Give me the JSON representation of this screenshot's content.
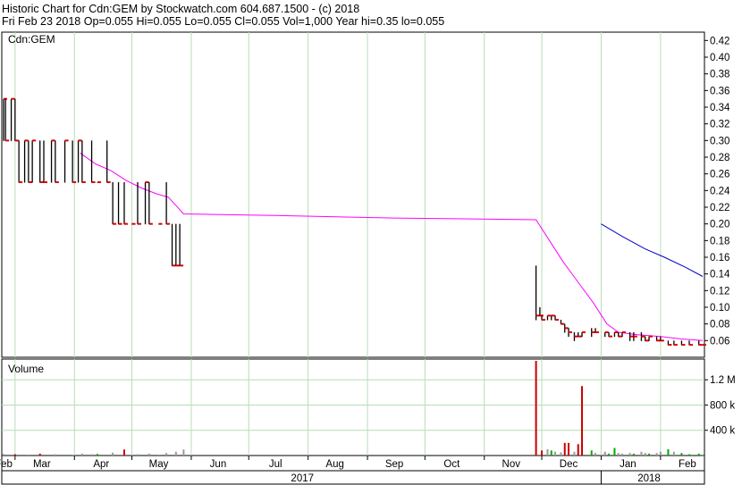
{
  "header": {
    "line1": "Historic Chart for Cdn:GEM by Stockwatch.com 604.687.1500 - (c) 2018",
    "line2": "Fri Feb 23 2018  Op=0.055  Hi=0.055  Lo=0.055  Cl=0.055  Vol=1,000  Year hi=0.35  lo=0.055"
  },
  "chart_data": {
    "type": "ohlc",
    "symbol_label": "Cdn:GEM",
    "price_axis": {
      "ylim": [
        0.04,
        0.43
      ],
      "ticks": [
        0.06,
        0.08,
        0.1,
        0.12,
        0.14,
        0.16,
        0.18,
        0.2,
        0.22,
        0.24,
        0.26,
        0.28,
        0.3,
        0.32,
        0.34,
        0.36,
        0.38,
        0.4,
        0.42
      ],
      "tick_labels": [
        "0.06",
        "0.08",
        "0.10",
        "0.12",
        "0.14",
        "0.16",
        "0.18",
        "0.20",
        "0.22",
        "0.24",
        "0.26",
        "0.28",
        "0.30",
        "0.32",
        "0.34",
        "0.36",
        "0.38",
        "0.40",
        "0.42"
      ]
    },
    "volume_axis": {
      "title": "Volume",
      "ylim": [
        0,
        1500000
      ],
      "ticks": [
        400000,
        800000,
        1200000
      ],
      "tick_labels": [
        "400 k",
        "800 k",
        "1.2 M"
      ]
    },
    "x_axis": {
      "range": [
        "2017-02-23",
        "2018-02-23"
      ],
      "month_labels": [
        {
          "label": "Feb",
          "date": "2017-02-23"
        },
        {
          "label": "Mar",
          "date": "2017-03-15"
        },
        {
          "label": "Apr",
          "date": "2017-04-15"
        },
        {
          "label": "May",
          "date": "2017-05-15"
        },
        {
          "label": "Jun",
          "date": "2017-06-15"
        },
        {
          "label": "Jul",
          "date": "2017-07-15"
        },
        {
          "label": "Aug",
          "date": "2017-08-15"
        },
        {
          "label": "Sep",
          "date": "2017-09-15"
        },
        {
          "label": "Oct",
          "date": "2017-10-15"
        },
        {
          "label": "Nov",
          "date": "2017-11-15"
        },
        {
          "label": "Dec",
          "date": "2017-12-15"
        },
        {
          "label": "Jan",
          "date": "2018-01-15"
        },
        {
          "label": "Feb",
          "date": "2018-02-15"
        }
      ],
      "month_grid": [
        "2017-03-01",
        "2017-04-01",
        "2017-05-01",
        "2017-06-01",
        "2017-07-01",
        "2017-08-01",
        "2017-09-01",
        "2017-10-01",
        "2017-11-01",
        "2017-12-01",
        "2018-01-01",
        "2018-02-01"
      ],
      "year_labels": [
        {
          "label": "2017",
          "date": "2017-07-29"
        },
        {
          "label": "2018",
          "date": "2018-01-26"
        }
      ],
      "year_divider": "2018-01-01"
    },
    "bars": [
      {
        "date": "2017-02-23",
        "high": 0.35,
        "low": 0.3,
        "close": 0.35
      },
      {
        "date": "2017-02-24",
        "high": 0.35,
        "low": 0.3,
        "close": 0.3
      },
      {
        "date": "2017-02-27",
        "high": 0.35,
        "low": 0.3,
        "close": 0.35
      },
      {
        "date": "2017-03-01",
        "high": 0.35,
        "low": 0.3,
        "close": 0.3
      },
      {
        "date": "2017-03-03",
        "high": 0.3,
        "low": 0.25,
        "close": 0.25
      },
      {
        "date": "2017-03-06",
        "high": 0.3,
        "low": 0.25,
        "close": 0.3
      },
      {
        "date": "2017-03-08",
        "high": 0.3,
        "low": 0.25,
        "close": 0.25
      },
      {
        "date": "2017-03-10",
        "high": 0.3,
        "low": 0.25,
        "close": 0.3
      },
      {
        "date": "2017-03-14",
        "high": 0.3,
        "low": 0.25,
        "close": 0.25
      },
      {
        "date": "2017-03-16",
        "high": 0.3,
        "low": 0.25,
        "close": 0.25
      },
      {
        "date": "2017-03-20",
        "high": 0.3,
        "low": 0.25,
        "close": 0.3
      },
      {
        "date": "2017-03-22",
        "high": 0.3,
        "low": 0.25,
        "close": 0.25
      },
      {
        "date": "2017-03-27",
        "high": 0.3,
        "low": 0.25,
        "close": 0.3
      },
      {
        "date": "2017-03-31",
        "high": 0.3,
        "low": 0.25,
        "close": 0.25
      },
      {
        "date": "2017-04-03",
        "high": 0.3,
        "low": 0.25,
        "close": 0.3
      },
      {
        "date": "2017-04-05",
        "high": 0.3,
        "low": 0.25,
        "close": 0.25
      },
      {
        "date": "2017-04-10",
        "high": 0.3,
        "low": 0.25,
        "close": 0.25
      },
      {
        "date": "2017-04-13",
        "high": 0.25,
        "low": 0.25,
        "close": 0.25
      },
      {
        "date": "2017-04-18",
        "high": 0.3,
        "low": 0.25,
        "close": 0.25
      },
      {
        "date": "2017-04-21",
        "high": 0.25,
        "low": 0.2,
        "close": 0.2
      },
      {
        "date": "2017-04-24",
        "high": 0.25,
        "low": 0.2,
        "close": 0.2
      },
      {
        "date": "2017-04-27",
        "high": 0.25,
        "low": 0.2,
        "close": 0.2
      },
      {
        "date": "2017-05-01",
        "high": 0.2,
        "low": 0.2,
        "close": 0.2
      },
      {
        "date": "2017-05-04",
        "high": 0.25,
        "low": 0.2,
        "close": 0.2
      },
      {
        "date": "2017-05-08",
        "high": 0.25,
        "low": 0.2,
        "close": 0.25
      },
      {
        "date": "2017-05-10",
        "high": 0.25,
        "low": 0.2,
        "close": 0.2
      },
      {
        "date": "2017-05-15",
        "high": 0.2,
        "low": 0.2,
        "close": 0.2
      },
      {
        "date": "2017-05-19",
        "high": 0.25,
        "low": 0.2,
        "close": 0.2
      },
      {
        "date": "2017-05-22",
        "high": 0.2,
        "low": 0.15,
        "close": 0.15
      },
      {
        "date": "2017-05-24",
        "high": 0.2,
        "low": 0.15,
        "close": 0.15
      },
      {
        "date": "2017-05-26",
        "high": 0.2,
        "low": 0.15,
        "close": 0.15
      },
      {
        "date": "2017-11-28",
        "high": 0.15,
        "low": 0.085,
        "close": 0.09
      },
      {
        "date": "2017-11-30",
        "high": 0.1,
        "low": 0.09,
        "close": 0.09
      },
      {
        "date": "2017-12-01",
        "high": 0.09,
        "low": 0.085,
        "close": 0.085
      },
      {
        "date": "2017-12-04",
        "high": 0.09,
        "low": 0.085,
        "close": 0.09
      },
      {
        "date": "2017-12-06",
        "high": 0.09,
        "low": 0.085,
        "close": 0.09
      },
      {
        "date": "2017-12-08",
        "high": 0.09,
        "low": 0.085,
        "close": 0.085
      },
      {
        "date": "2017-12-11",
        "high": 0.085,
        "low": 0.08,
        "close": 0.08
      },
      {
        "date": "2017-12-13",
        "high": 0.08,
        "low": 0.07,
        "close": 0.075
      },
      {
        "date": "2017-12-15",
        "high": 0.075,
        "low": 0.065,
        "close": 0.07
      },
      {
        "date": "2017-12-18",
        "high": 0.07,
        "low": 0.06,
        "close": 0.065
      },
      {
        "date": "2017-12-20",
        "high": 0.07,
        "low": 0.065,
        "close": 0.065
      },
      {
        "date": "2017-12-22",
        "high": 0.07,
        "low": 0.065,
        "close": 0.07
      },
      {
        "date": "2017-12-27",
        "high": 0.075,
        "low": 0.065,
        "close": 0.07
      },
      {
        "date": "2017-12-29",
        "high": 0.075,
        "low": 0.07,
        "close": 0.07
      },
      {
        "date": "2018-01-03",
        "high": 0.07,
        "low": 0.065,
        "close": 0.07
      },
      {
        "date": "2018-01-05",
        "high": 0.07,
        "low": 0.065,
        "close": 0.065
      },
      {
        "date": "2018-01-08",
        "high": 0.07,
        "low": 0.065,
        "close": 0.07
      },
      {
        "date": "2018-01-10",
        "high": 0.07,
        "low": 0.065,
        "close": 0.065
      },
      {
        "date": "2018-01-12",
        "high": 0.07,
        "low": 0.065,
        "close": 0.07
      },
      {
        "date": "2018-01-16",
        "high": 0.07,
        "low": 0.06,
        "close": 0.065
      },
      {
        "date": "2018-01-18",
        "high": 0.07,
        "low": 0.06,
        "close": 0.065
      },
      {
        "date": "2018-01-22",
        "high": 0.07,
        "low": 0.06,
        "close": 0.065
      },
      {
        "date": "2018-01-24",
        "high": 0.065,
        "low": 0.06,
        "close": 0.06
      },
      {
        "date": "2018-01-26",
        "high": 0.065,
        "low": 0.06,
        "close": 0.065
      },
      {
        "date": "2018-01-30",
        "high": 0.065,
        "low": 0.06,
        "close": 0.06
      },
      {
        "date": "2018-02-01",
        "high": 0.065,
        "low": 0.06,
        "close": 0.06
      },
      {
        "date": "2018-02-05",
        "high": 0.06,
        "low": 0.055,
        "close": 0.055
      },
      {
        "date": "2018-02-08",
        "high": 0.06,
        "low": 0.055,
        "close": 0.055
      },
      {
        "date": "2018-02-12",
        "high": 0.06,
        "low": 0.055,
        "close": 0.055
      },
      {
        "date": "2018-02-16",
        "high": 0.06,
        "low": 0.055,
        "close": 0.055
      },
      {
        "date": "2018-02-21",
        "high": 0.06,
        "low": 0.055,
        "close": 0.055
      },
      {
        "date": "2018-02-23",
        "high": 0.055,
        "low": 0.055,
        "close": 0.055
      }
    ],
    "moving_averages": [
      {
        "color": "#ff00ff",
        "points": [
          [
            "2017-04-04",
            0.285
          ],
          [
            "2017-04-12",
            0.272
          ],
          [
            "2017-04-20",
            0.264
          ],
          [
            "2017-04-28",
            0.252
          ],
          [
            "2017-05-06",
            0.243
          ],
          [
            "2017-05-14",
            0.236
          ],
          [
            "2017-05-20",
            0.232
          ],
          [
            "2017-05-24",
            0.222
          ],
          [
            "2017-05-28",
            0.212
          ],
          [
            "2017-07-15",
            0.21
          ],
          [
            "2017-09-15",
            0.207
          ],
          [
            "2017-11-28",
            0.205
          ],
          [
            "2017-12-05",
            0.18
          ],
          [
            "2017-12-12",
            0.155
          ],
          [
            "2017-12-20",
            0.13
          ],
          [
            "2017-12-28",
            0.105
          ],
          [
            "2018-01-04",
            0.08
          ],
          [
            "2018-01-10",
            0.07
          ],
          [
            "2018-01-20",
            0.067
          ],
          [
            "2018-02-01",
            0.065
          ],
          [
            "2018-02-12",
            0.062
          ],
          [
            "2018-02-23",
            0.06
          ]
        ]
      },
      {
        "color": "#0000cc",
        "points": [
          [
            "2018-01-01",
            0.2
          ],
          [
            "2018-01-12",
            0.185
          ],
          [
            "2018-01-24",
            0.17
          ],
          [
            "2018-02-03",
            0.16
          ],
          [
            "2018-02-14",
            0.148
          ],
          [
            "2018-02-23",
            0.137
          ]
        ]
      }
    ],
    "volume_colors": {
      "up": "#00aa00",
      "down": "#cc0000",
      "flat": "#999999"
    },
    "volume": [
      [
        "2017-02-23",
        25000,
        "flat"
      ],
      [
        "2017-03-01",
        20000,
        "down"
      ],
      [
        "2017-03-08",
        15000,
        "flat"
      ],
      [
        "2017-03-14",
        30000,
        "down"
      ],
      [
        "2017-03-22",
        20000,
        "flat"
      ],
      [
        "2017-03-31",
        15000,
        "flat"
      ],
      [
        "2017-04-05",
        30000,
        "flat"
      ],
      [
        "2017-04-10",
        20000,
        "flat"
      ],
      [
        "2017-04-13",
        25000,
        "up"
      ],
      [
        "2017-04-21",
        45000,
        "flat"
      ],
      [
        "2017-04-27",
        95000,
        "down"
      ],
      [
        "2017-05-04",
        20000,
        "flat"
      ],
      [
        "2017-05-10",
        30000,
        "flat"
      ],
      [
        "2017-05-15",
        15000,
        "flat"
      ],
      [
        "2017-05-19",
        40000,
        "flat"
      ],
      [
        "2017-05-24",
        60000,
        "flat"
      ],
      [
        "2017-05-28",
        95000,
        "flat"
      ],
      [
        "2017-11-28",
        1500000,
        "down"
      ],
      [
        "2017-12-01",
        80000,
        "down"
      ],
      [
        "2017-12-04",
        100000,
        "flat"
      ],
      [
        "2017-12-06",
        80000,
        "up"
      ],
      [
        "2017-12-08",
        60000,
        "flat"
      ],
      [
        "2017-12-11",
        50000,
        "flat"
      ],
      [
        "2017-12-13",
        200000,
        "down"
      ],
      [
        "2017-12-15",
        200000,
        "down"
      ],
      [
        "2017-12-18",
        60000,
        "flat"
      ],
      [
        "2017-12-20",
        180000,
        "down"
      ],
      [
        "2017-12-22",
        1100000,
        "down"
      ],
      [
        "2017-12-27",
        80000,
        "up"
      ],
      [
        "2017-12-29",
        40000,
        "flat"
      ],
      [
        "2018-01-03",
        60000,
        "flat"
      ],
      [
        "2018-01-05",
        30000,
        "up"
      ],
      [
        "2018-01-08",
        120000,
        "up"
      ],
      [
        "2018-01-10",
        40000,
        "flat"
      ],
      [
        "2018-01-12",
        30000,
        "flat"
      ],
      [
        "2018-01-16",
        40000,
        "flat"
      ],
      [
        "2018-01-18",
        30000,
        "up"
      ],
      [
        "2018-01-22",
        60000,
        "flat"
      ],
      [
        "2018-01-24",
        40000,
        "flat"
      ],
      [
        "2018-01-26",
        30000,
        "up"
      ],
      [
        "2018-01-30",
        40000,
        "flat"
      ],
      [
        "2018-02-01",
        60000,
        "flat"
      ],
      [
        "2018-02-05",
        100000,
        "up"
      ],
      [
        "2018-02-08",
        60000,
        "flat"
      ],
      [
        "2018-02-12",
        40000,
        "up"
      ],
      [
        "2018-02-16",
        20000,
        "up"
      ],
      [
        "2018-02-21",
        30000,
        "up"
      ],
      [
        "2018-02-23",
        10000,
        "up"
      ]
    ]
  }
}
